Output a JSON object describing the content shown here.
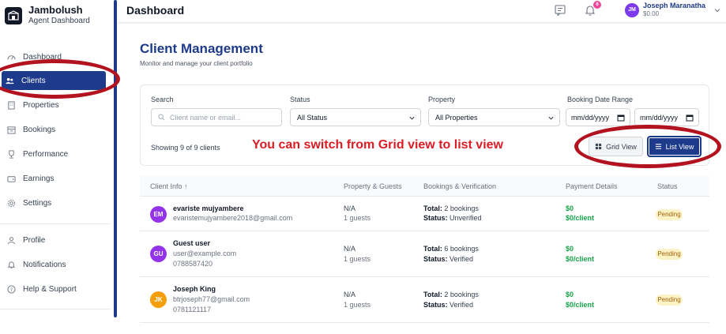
{
  "brand": {
    "name": "Jambolush",
    "subtitle": "Agent Dashboard"
  },
  "sidebar": {
    "items": [
      {
        "label": "Dashboard",
        "icon": "dashboard-icon"
      },
      {
        "label": "Clients",
        "icon": "users-icon",
        "active": true
      },
      {
        "label": "Properties",
        "icon": "building-icon"
      },
      {
        "label": "Bookings",
        "icon": "calendar-icon"
      },
      {
        "label": "Performance",
        "icon": "trophy-icon"
      },
      {
        "label": "Earnings",
        "icon": "wallet-icon"
      },
      {
        "label": "Settings",
        "icon": "gear-icon"
      },
      {
        "label": "Profile",
        "icon": "user-icon"
      },
      {
        "label": "Notifications",
        "icon": "bell-icon"
      },
      {
        "label": "Help & Support",
        "icon": "help-icon"
      }
    ]
  },
  "topbar": {
    "title": "Dashboard",
    "notification_count": "6",
    "user": {
      "initials": "JM",
      "name": "Joseph Maranatha",
      "balance": "$0.00"
    }
  },
  "page": {
    "title": "Client Management",
    "subtitle": "Monitor and manage your client portfolio"
  },
  "filters": {
    "search": {
      "label": "Search",
      "placeholder": "Client name or email..."
    },
    "status": {
      "label": "Status",
      "value": "All Status"
    },
    "property": {
      "label": "Property",
      "value": "All Properties"
    },
    "date_range": {
      "label": "Booking Date Range",
      "from_placeholder": "mm/dd/yyyy",
      "to_placeholder": "mm/dd/yyyy"
    },
    "showing_text": "Showing 9 of 9 clients",
    "grid_view_label": "Grid View",
    "list_view_label": "List View",
    "active_view": "list"
  },
  "annotation": {
    "text": "You can switch from Grid view to list view",
    "color": "#dc1c24"
  },
  "table": {
    "headers": [
      "Client Info ↑",
      "Property & Guests",
      "Bookings & Verification",
      "Payment Details",
      "Status"
    ],
    "rows": [
      {
        "initials": "EM",
        "avatar_color": "#9333ea",
        "name": "evariste mujyambere",
        "email": "evaristemujyambere2018@gmail.com",
        "phone": "",
        "property": "N/A",
        "guests": "1 guests",
        "total_label": "Total:",
        "total": "2 bookings",
        "status_label": "Status:",
        "verification": "Unverified",
        "amount": "$0",
        "per_client": "$0/client",
        "status": "Pending"
      },
      {
        "initials": "GU",
        "avatar_color": "#9333ea",
        "name": "Guest user",
        "email": "user@example.com",
        "phone": "0788587420",
        "property": "N/A",
        "guests": "1 guests",
        "total_label": "Total:",
        "total": "6 bookings",
        "status_label": "Status:",
        "verification": "Verified",
        "amount": "$0",
        "per_client": "$0/client",
        "status": "Pending"
      },
      {
        "initials": "JK",
        "avatar_color": "#f59e0b",
        "name": "Joseph King",
        "email": "btrjoseph77@gmail.com",
        "phone": "0781121117",
        "property": "N/A",
        "guests": "1 guests",
        "total_label": "Total:",
        "total": "2 bookings",
        "status_label": "Status:",
        "verification": "Verified",
        "amount": "$0",
        "per_client": "$0/client",
        "status": "Pending"
      }
    ]
  },
  "colors": {
    "brand_blue": "#1e3a8a",
    "pending_bg": "#fef3c7",
    "money_green": "#16a34a",
    "highlight_red": "#b3121f"
  }
}
